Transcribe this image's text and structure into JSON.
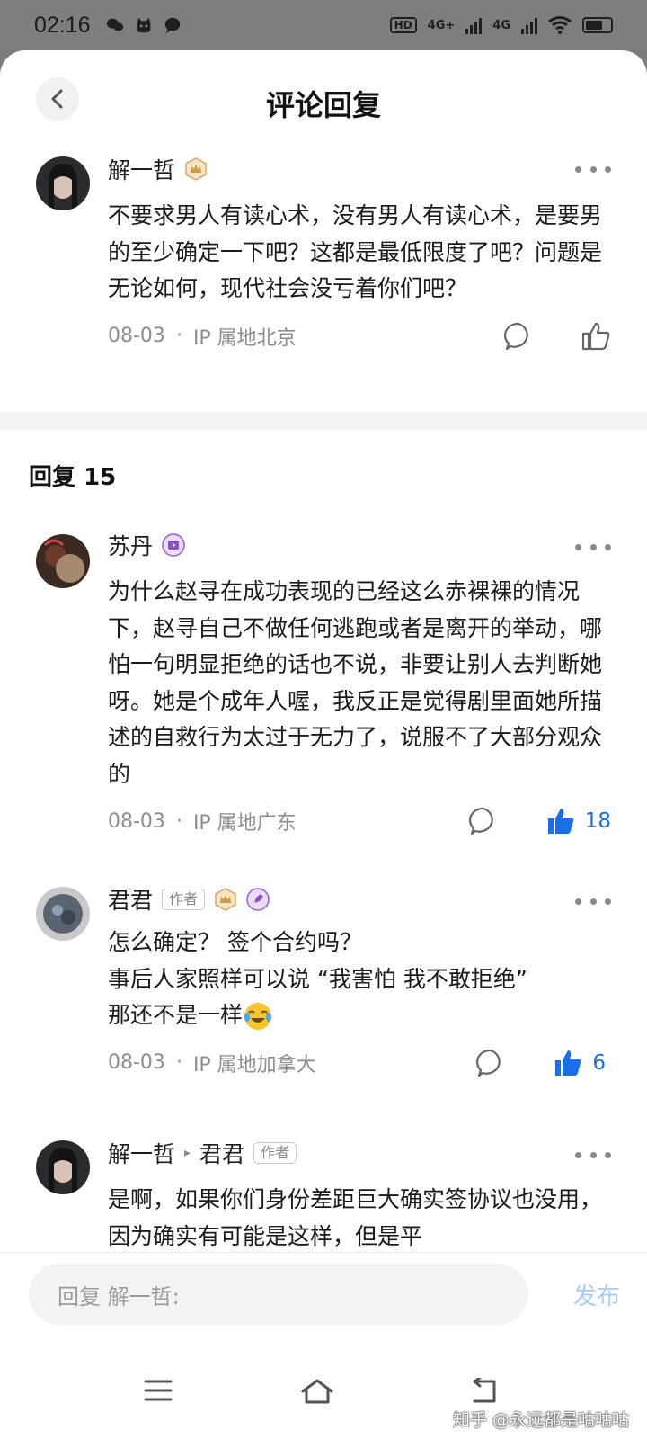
{
  "status_bar": {
    "time": "02:16",
    "network_1": "4G+",
    "network_2": "4G",
    "hd_label": "HD"
  },
  "header": {
    "title": "评论回复"
  },
  "main_comment": {
    "user": "解一哲",
    "text": "不要求男人有读心术，没有男人有读心术，是要男的至少确定一下吧？这都是最低限度了吧？问题是无论如何，现代社会没亏着你们吧？",
    "date": "08-03",
    "location": "IP 属地北京"
  },
  "replies_title": "回复 15",
  "replies": [
    {
      "user": "苏丹",
      "text": "为什么赵寻在成功表现的已经这么赤裸裸的情况下，赵寻自己不做任何逃跑或者是离开的举动，哪怕一句明显拒绝的话也不说，非要让别人去判断她呀。她是个成年人喔，我反正是觉得剧里面她所描述的自救行为太过于无力了，说服不了大部分观众的",
      "date": "08-03",
      "location": "IP 属地广东",
      "likes": "18"
    },
    {
      "user": "君君",
      "tag": "作者",
      "line1": "怎么确定？ 签个合约吗？",
      "line2": "事后人家照样可以说 “我害怕 我不敢拒绝”",
      "line3": "那还不是一样",
      "date": "08-03",
      "location": "IP 属地加拿大",
      "likes": "6"
    },
    {
      "user": "解一哲",
      "reply_to": "君君",
      "tag": "作者",
      "text": "是啊，如果你们身份差距巨大确实签协议也没用，因为确实有可能是这样，但是平"
    }
  ],
  "composer": {
    "placeholder": "回复 解一哲:",
    "publish": "发布"
  },
  "watermark": "知乎 @永远都是咕咕咕",
  "colors": {
    "accent": "#1a6ee8",
    "publish_disabled": "#a9cdf5"
  }
}
